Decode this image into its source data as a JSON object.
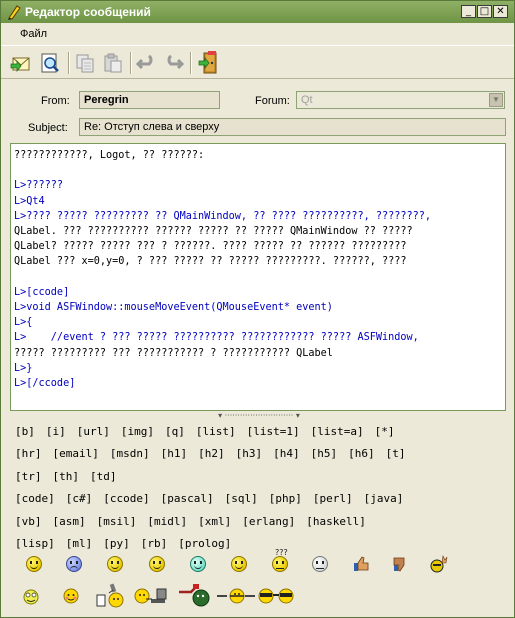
{
  "window": {
    "title": "Редактор сообщений",
    "minimize": "_",
    "maximize": "□",
    "close": "✕"
  },
  "menu": {
    "file": "Файл"
  },
  "toolbar": {
    "icons": [
      "send-icon",
      "preview-icon",
      "copy-icon",
      "paste-icon",
      "undo-icon",
      "redo-icon",
      "exit-icon"
    ]
  },
  "form": {
    "from_label": "From:",
    "from_value": "Peregrin",
    "forum_label": "Forum:",
    "forum_value": "Qt",
    "subject_label": "Subject:",
    "subject_value": "Re: Отступ слева и сверху"
  },
  "editor": {
    "lines": [
      "????????????, Logot, ?? ??????:",
      "",
      "L>??????",
      "L>Qt4",
      "L>???? ????? ????????? ?? QMainWindow, ?? ???? ??????????, ????????,",
      "QLabel. ??? ?????????? ?????? ????? ?? ????? QMainWindow ?? ?????",
      "QLabel? ????? ????? ??? ? ??????. ???? ????? ?? ?????? ?????????",
      "QLabel ??? x=0,y=0, ? ??? ????? ?? ????? ?????????. ??????, ????",
      "",
      "L>[ccode]",
      "L>void ASFWindow::mouseMoveEvent(QMouseEvent* event)",
      "L>{",
      "L>    //event ? ??? ????? ?????????? ???????????? ????? ASFWindow,",
      "????? ????????? ??? ??????????? ? ??????????? QLabel",
      "L>}",
      "L>[/ccode]"
    ]
  },
  "tags": {
    "rows": [
      [
        "[b]",
        "[i]",
        "[url]",
        "[img]",
        "[q]",
        "[list]",
        "[list=1]",
        "[list=a]",
        "[*]"
      ],
      [
        "[hr]",
        "[email]",
        "[msdn]",
        "[h1]",
        "[h2]",
        "[h3]",
        "[h4]",
        "[h5]",
        "[h6]",
        "[t]"
      ],
      [
        "[tr]",
        "[th]",
        "[td]"
      ],
      [
        "[code]",
        "[c#]",
        "[ccode]",
        "[pascal]",
        "[sql]",
        "[php]",
        "[perl]",
        "[java]"
      ],
      [
        "[vb]",
        "[asm]",
        "[msil]",
        "[midl]",
        "[xml]",
        "[erlang]",
        "[haskell]"
      ],
      [
        "[lisp]",
        "[ml]",
        "[py]",
        "[rb]",
        "[prolog]"
      ]
    ]
  },
  "smilies": {
    "row1": [
      "smile-icon",
      "frown-icon",
      "wink-icon",
      "grin-icon",
      "cool-icon",
      "beer-icon",
      "confused-icon",
      "shocked-icon",
      "thumbs-up-icon",
      "thumbs-down-icon",
      "devil-icon"
    ],
    "row2": [
      "crazy-icon",
      "shy-icon",
      "writer-icon",
      "typing-icon",
      "weapon-icon",
      "fight-icon",
      "binoculars-icon"
    ],
    "confused_text": "???"
  }
}
